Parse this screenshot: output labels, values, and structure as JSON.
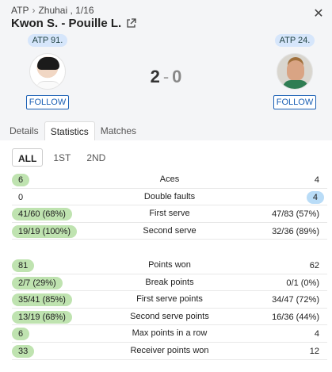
{
  "breadcrumb": {
    "tour": "ATP",
    "event": "Zhuhai , 1/16"
  },
  "match_title": "Kwon S. - Pouille L.",
  "players": {
    "left": {
      "rank": "ATP 91.",
      "follow": "FOLLOW"
    },
    "right": {
      "rank": "ATP 24.",
      "follow": "FOLLOW"
    }
  },
  "score": {
    "home": "2",
    "separator": "-",
    "away": "0"
  },
  "tabs": [
    "Details",
    "Statistics",
    "Matches"
  ],
  "active_tab": "Statistics",
  "periods": [
    "ALL",
    "1ST",
    "2ND"
  ],
  "active_period": "ALL",
  "colors": {
    "winner_highlight": "#bfe3b0",
    "away_highlight": "#b9dcf7",
    "follow_blue": "#1a5fb4"
  },
  "stats_group1": [
    {
      "label": "Aces",
      "home": "6",
      "away": "4",
      "highlight": "home"
    },
    {
      "label": "Double faults",
      "home": "0",
      "away": "4",
      "highlight": "away"
    },
    {
      "label": "First serve",
      "home": "41/60 (68%)",
      "away": "47/83 (57%)",
      "highlight": "home"
    },
    {
      "label": "Second serve",
      "home": "19/19 (100%)",
      "away": "32/36 (89%)",
      "highlight": "home"
    }
  ],
  "stats_group2": [
    {
      "label": "Points won",
      "home": "81",
      "away": "62",
      "highlight": "home"
    },
    {
      "label": "Break points",
      "home": "2/7 (29%)",
      "away": "0/1 (0%)",
      "highlight": "home"
    },
    {
      "label": "First serve points",
      "home": "35/41 (85%)",
      "away": "34/47 (72%)",
      "highlight": "home"
    },
    {
      "label": "Second serve points",
      "home": "13/19 (68%)",
      "away": "16/36 (44%)",
      "highlight": "home"
    },
    {
      "label": "Max points in a row",
      "home": "6",
      "away": "4",
      "highlight": "home"
    },
    {
      "label": "Receiver points won",
      "home": "33",
      "away": "12",
      "highlight": "home"
    }
  ]
}
